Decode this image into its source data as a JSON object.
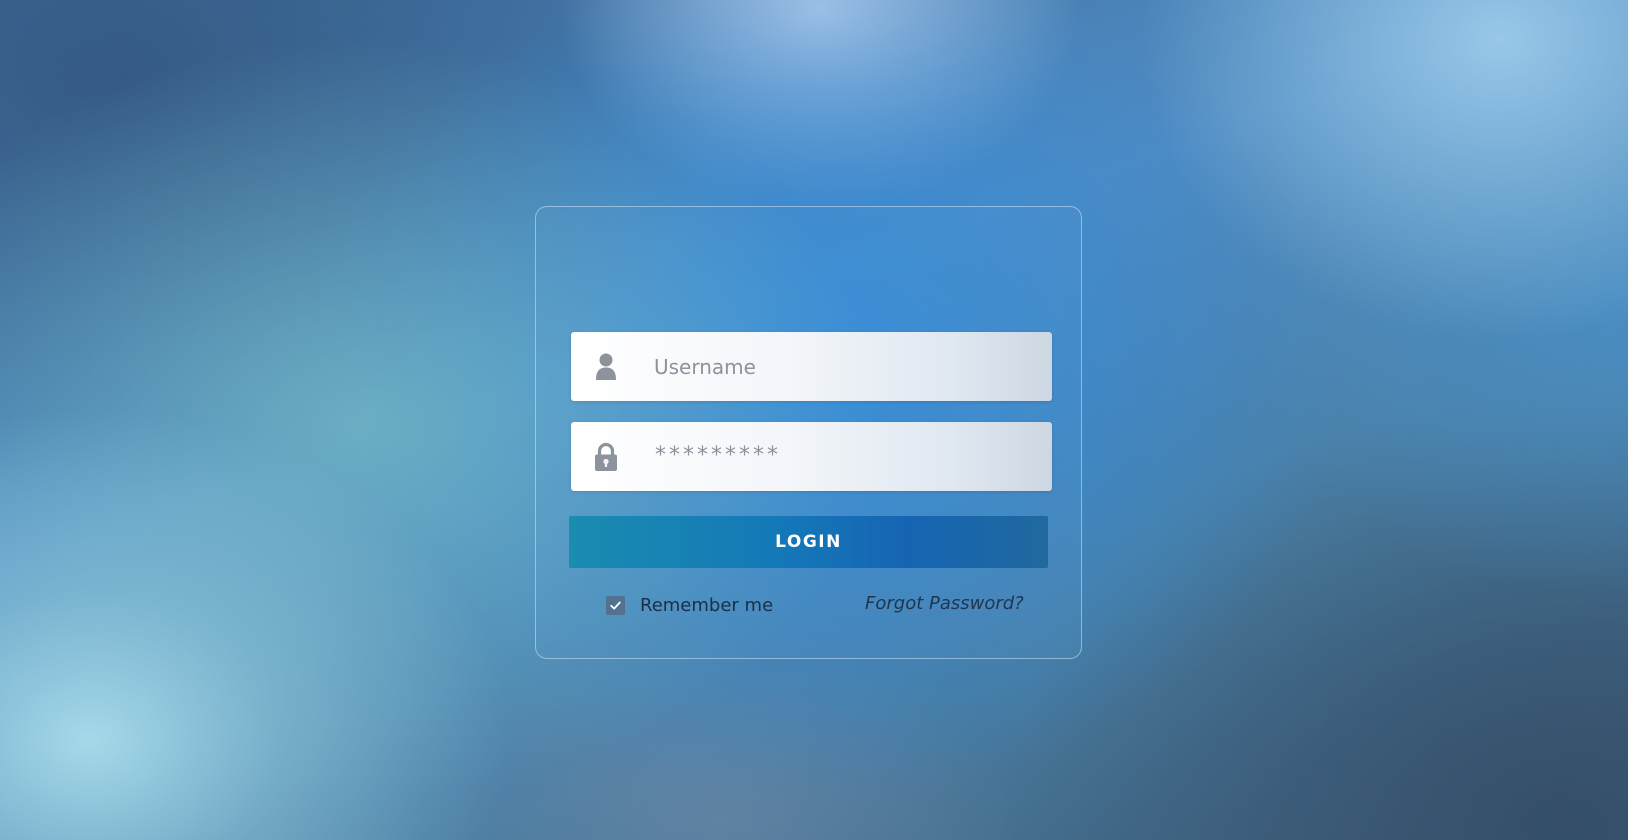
{
  "login_form": {
    "username": {
      "icon": "user-icon",
      "placeholder": "Username",
      "value": ""
    },
    "password": {
      "icon": "lock-icon",
      "masked_value": "*********"
    },
    "login_button_label": "LOGIN",
    "remember_me": {
      "label": "Remember me",
      "checked": true
    },
    "forgot_password_label": "Forgot Password?"
  },
  "colors": {
    "button_start": "#1a8cb0",
    "button_end": "#1665b4",
    "checkbox_fill": "#52728f",
    "icon_gray": "#8d939c"
  }
}
